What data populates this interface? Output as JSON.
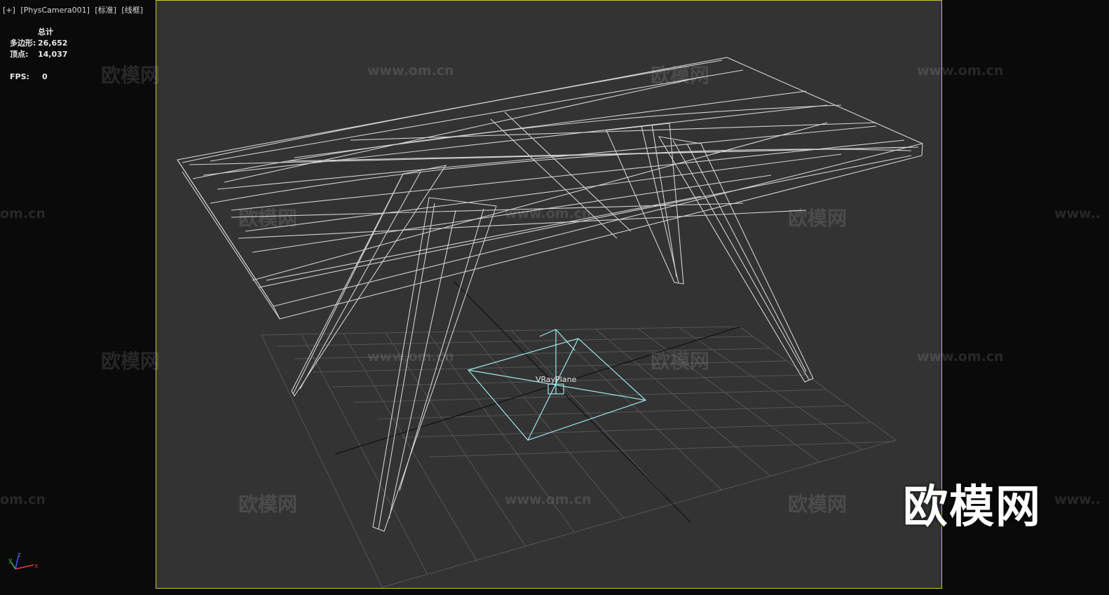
{
  "viewport": {
    "labels": [
      "[+]",
      "[PhysCamera001]",
      "[标准]",
      "[线框]"
    ]
  },
  "stats": {
    "header": "总计",
    "rows": [
      {
        "key": "多边形:",
        "value": "26,652"
      },
      {
        "key": "顶点:",
        "value": "14,037"
      },
      {
        "key": "FPS:",
        "value": "0"
      }
    ]
  },
  "scene": {
    "object_label": "VRayPlane"
  },
  "watermarks": {
    "cn": "欧模网",
    "url": "www.om.cn",
    "url_partial": "om.cn",
    "url_prefix": "www.."
  },
  "brand": {
    "text": "欧模网"
  },
  "axis": {
    "x": "x",
    "y": "y",
    "z": "z"
  },
  "colors": {
    "viewport_bg": "#333333",
    "viewport_border": "#c8c832",
    "wire": "#cfcfcf",
    "vray": "#9ee5e5",
    "grid": "#5a5a5a"
  }
}
